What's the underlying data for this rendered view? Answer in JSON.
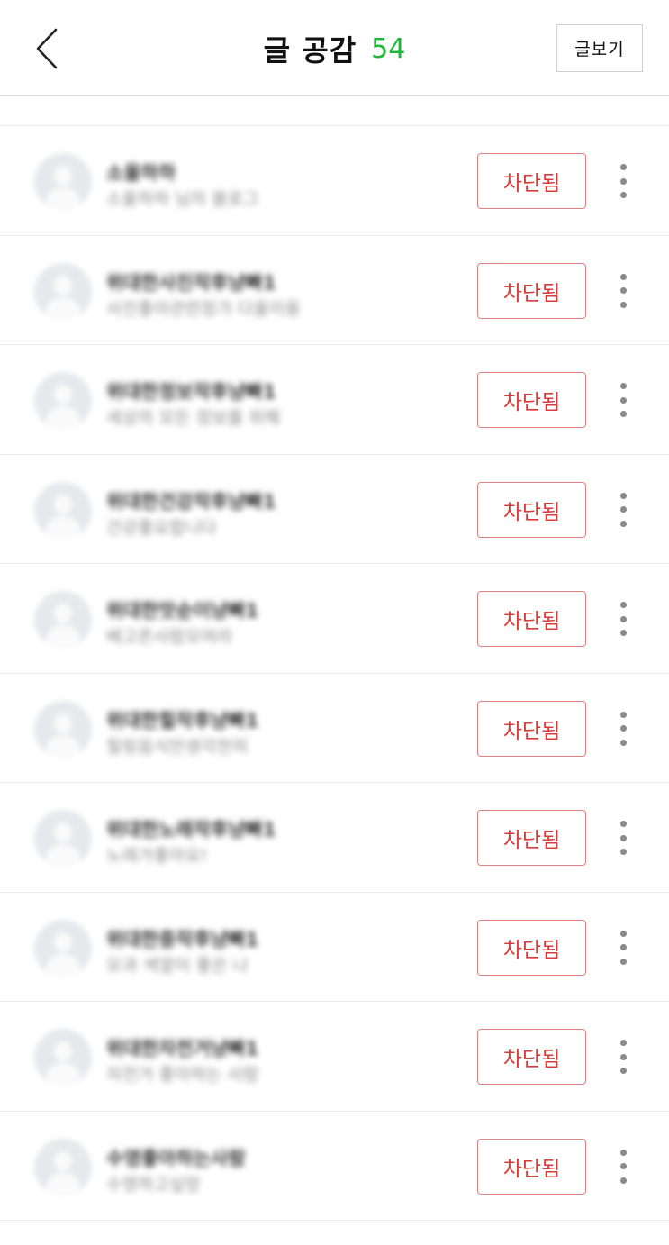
{
  "header": {
    "title": "글 공감",
    "count": "54",
    "view_post_label": "글보기",
    "back_icon": "chevron-left-icon"
  },
  "users": [
    {
      "name": "소울하하",
      "desc": "소울하하 님의 블로그",
      "status": "차단됨"
    },
    {
      "name": "위대한사진작후냥빠1",
      "desc": "사진좋아관련정가 다올이용",
      "status": "차단됨"
    },
    {
      "name": "위대한정보작후냥빠1",
      "desc": "세상의 모든 정보를 위해",
      "status": "차단됨"
    },
    {
      "name": "위대한건강작후냥빠1",
      "desc": "건강좋요합니다",
      "status": "차단됨"
    },
    {
      "name": "위대한맛순이냥빠1",
      "desc": "배고픈사람모여라",
      "status": "차단됨"
    },
    {
      "name": "위대한힐작후냥빠1",
      "desc": "힐링음식만생각천히",
      "status": "차단됨"
    },
    {
      "name": "위대한노래작후냥빠1",
      "desc": "노래가좋아요!",
      "status": "차단됨"
    },
    {
      "name": "위대한중작후냥빠1",
      "desc": "모과 색깔이 좋은 나",
      "status": "차단됨"
    },
    {
      "name": "위대한자전거냥빠1",
      "desc": "자전거 좋아하는 사람",
      "status": "차단됨"
    },
    {
      "name": "수영좋아하는사람",
      "desc": "수영하고싶망",
      "status": "차단됨"
    }
  ],
  "colors": {
    "count_green": "#1fb83a",
    "blocked_red": "#d93b3b",
    "blocked_border": "#e38080"
  }
}
